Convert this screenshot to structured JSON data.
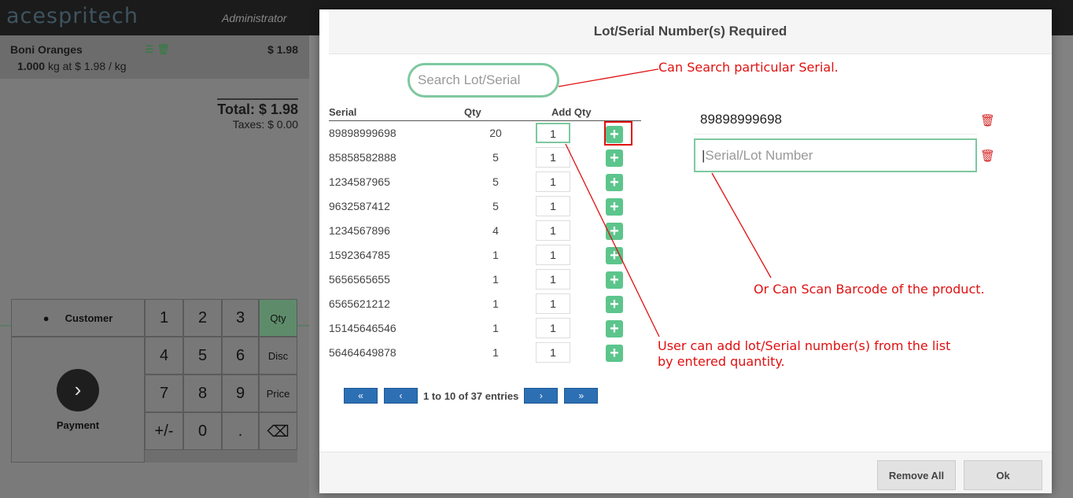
{
  "pos": {
    "logo": "acespritech",
    "user": "Administrator",
    "order_line": {
      "name": "Boni Oranges",
      "price": "$ 1.98",
      "qty": "1.000",
      "detail": "kg at $ 1.98 / kg"
    },
    "total": "Total: $ 1.98",
    "taxes": "Taxes: $ 0.00",
    "customer_label": "Customer",
    "payment_label": "Payment",
    "keys": [
      "1",
      "2",
      "3",
      "Qty",
      "4",
      "5",
      "6",
      "Disc",
      "7",
      "8",
      "9",
      "Price",
      "+/-",
      "0",
      ".",
      "⌫"
    ]
  },
  "modal": {
    "title": "Lot/Serial Number(s) Required",
    "search_placeholder": "Search Lot/Serial",
    "columns": [
      "Serial",
      "Qty",
      "Add Qty"
    ],
    "rows": [
      {
        "serial": "89898999698",
        "qty": "20",
        "add": "1"
      },
      {
        "serial": "85858582888",
        "qty": "5",
        "add": "1"
      },
      {
        "serial": "1234587965",
        "qty": "5",
        "add": "1"
      },
      {
        "serial": "9632587412",
        "qty": "5",
        "add": "1"
      },
      {
        "serial": "1234567896",
        "qty": "4",
        "add": "1"
      },
      {
        "serial": "1592364785",
        "qty": "1",
        "add": "1"
      },
      {
        "serial": "5656565655",
        "qty": "1",
        "add": "1"
      },
      {
        "serial": "6565621212",
        "qty": "1",
        "add": "1"
      },
      {
        "serial": "15145646546",
        "qty": "1",
        "add": "1"
      },
      {
        "serial": "56464649878",
        "qty": "1",
        "add": "1"
      }
    ],
    "pager": {
      "first": "«",
      "prev": "‹",
      "info": "1 to 10 of 37 entries",
      "next": "›",
      "last": "»"
    },
    "lot_values": [
      "89898999698"
    ],
    "lot_placeholder": "Serial/Lot Number",
    "remove_all": "Remove All",
    "ok": "Ok"
  },
  "annotations": {
    "search": "Can Search particular Serial.",
    "scan": "Or Can Scan Barcode of the product.",
    "add_line1": "User can add lot/Serial number(s) from the list",
    "add_line2": "by entered quantity."
  },
  "colors": {
    "accent_green": "#5cc58c",
    "annotation_red": "#e01010",
    "pager_blue": "#2d6fb3"
  }
}
